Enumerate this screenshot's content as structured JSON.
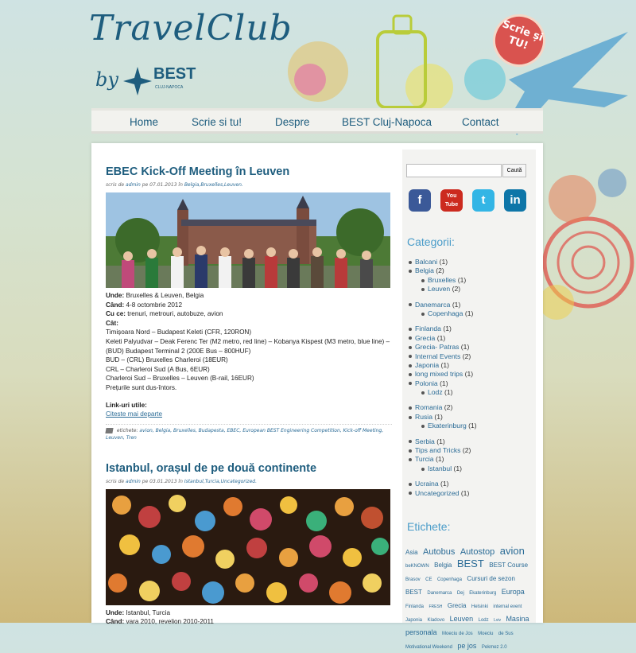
{
  "site": {
    "logo_text": "TravelClub",
    "logo_by": "by",
    "best_logo_text": "BEST",
    "best_logo_sub": "CLUJ-NAPOCA",
    "scrie_tag": "Scrie și TU!"
  },
  "nav": {
    "items": [
      {
        "label": "Home"
      },
      {
        "label": "Scrie si tu!"
      },
      {
        "label": "Despre"
      },
      {
        "label": "BEST Cluj-Napoca"
      },
      {
        "label": "Contact"
      }
    ]
  },
  "posts": [
    {
      "title": "EBEC Kick-Off Meeting în Leuven",
      "meta_prefix": "scris de",
      "meta_author": "admin",
      "meta_on": "pe 07.01.2013 în",
      "meta_cats": "Belgia,Bruxelles,Leuven.",
      "unde_label": "Unde:",
      "unde_value": " Bruxelles & Leuven, Belgia",
      "cand_label": "Când:",
      "cand_value": " 4-8 octombrie 2012",
      "cu_ce_label": "Cu ce:",
      "cu_ce_value": " trenuri, metrouri, autobuze, avion",
      "cat_label": "Cât:",
      "cat_lines": [
        "Timișoara Nord – Budapest Keleti (CFR, 120RON)",
        "Keleti Palyudvar – Deak Ferenc Ter (M2 metro, red line) – Kobanya Kispest (M3 metro, blue line) – (BUD) Budapest Terminal 2 (200E Bus – 800HUF)",
        "BUD – (CRL) Bruxelles Charleroi (18EUR)",
        "CRL – Charleroi Sud (A Bus, 6EUR)",
        "Charleroi Sud – Bruxelles – Leuven (B-rail, 16EUR)",
        "Prețurile sunt dus-întors."
      ],
      "links_label": "Link-uri utile:",
      "link_text": "Citeste mai departe",
      "tags_prefix": "etichete:",
      "tags": "avion, Belgia, Bruxelles, Budapesta, EBEC, European BEST Engineering Competition, Kick-off Meeting, Leuven, Tren"
    },
    {
      "title": "Istanbul, orașul de pe două continente",
      "meta_prefix": "scris de",
      "meta_author": "admin",
      "meta_on": "pe 03.01.2013 în",
      "meta_cats": "Istanbul,Turcia,Uncategorized.",
      "unde_label": "Unde:",
      "unde_value": " Istanbul, Turcia",
      "cand_label": "Când:",
      "cand_value": " vara 2010, revelion 2010-2011"
    }
  ],
  "sidebar": {
    "search_placeholder": "",
    "search_button": "Caută",
    "social": [
      {
        "label": "f",
        "color": "#3b5998"
      },
      {
        "label": "You Tube",
        "color": "#cc2a1f"
      },
      {
        "label": "t",
        "color": "#33b5e5"
      },
      {
        "label": "in",
        "color": "#0e76a8"
      }
    ],
    "categories_title": "Categorii:",
    "categories": [
      {
        "name": "Balcani",
        "count": "(1)",
        "level": 0
      },
      {
        "name": "Belgia",
        "count": "(2)",
        "level": 0
      },
      {
        "name": "Bruxelles",
        "count": "(1)",
        "level": 1
      },
      {
        "name": "Leuven",
        "count": "(2)",
        "level": 1
      },
      {
        "gap": true
      },
      {
        "name": "Danemarca",
        "count": "(1)",
        "level": 0
      },
      {
        "name": "Copenhaga",
        "count": "(1)",
        "level": 1
      },
      {
        "gap": true
      },
      {
        "name": "Finlanda",
        "count": "(1)",
        "level": 0
      },
      {
        "name": "Grecia",
        "count": "(1)",
        "level": 0
      },
      {
        "name": "Grecia- Patras",
        "count": "(1)",
        "level": 0
      },
      {
        "name": "Internal Events",
        "count": "(2)",
        "level": 0
      },
      {
        "name": "Japonia",
        "count": "(1)",
        "level": 0
      },
      {
        "name": "long mixed trips",
        "count": "(1)",
        "level": 0
      },
      {
        "name": "Polonia",
        "count": "(1)",
        "level": 0
      },
      {
        "name": "Lodz",
        "count": "(1)",
        "level": 1
      },
      {
        "gap": true
      },
      {
        "name": "Romania",
        "count": "(2)",
        "level": 0
      },
      {
        "name": "Rusia",
        "count": "(1)",
        "level": 0
      },
      {
        "name": "Ekaterinburg",
        "count": "(1)",
        "level": 1
      },
      {
        "gap": true
      },
      {
        "name": "Serbia",
        "count": "(1)",
        "level": 0
      },
      {
        "name": "Tips and Tricks",
        "count": "(2)",
        "level": 0
      },
      {
        "name": "Turcia",
        "count": "(1)",
        "level": 0
      },
      {
        "name": "Istanbul",
        "count": "(1)",
        "level": 1
      },
      {
        "gap": true
      },
      {
        "name": "Ucraina",
        "count": "(1)",
        "level": 0
      },
      {
        "name": "Uncategorized",
        "count": "(1)",
        "level": 0
      }
    ],
    "tags_title": "Etichete:",
    "tag_cloud": [
      {
        "t": "Asia",
        "s": 8
      },
      {
        "t": "Autobus",
        "s": 11
      },
      {
        "t": "Autostop",
        "s": 11
      },
      {
        "t": "avion",
        "s": 13
      },
      {
        "t": "beKNOWN",
        "s": 6
      },
      {
        "t": "Belgia",
        "s": 8
      },
      {
        "t": "BEST",
        "s": 13
      },
      {
        "t": "BEST Course",
        "s": 8
      },
      {
        "t": "Brasov",
        "s": 6
      },
      {
        "t": "CE",
        "s": 6
      },
      {
        "t": "Copenhaga",
        "s": 6
      },
      {
        "t": "Cursuri de sezon",
        "s": 8
      },
      {
        "t": "BEST",
        "s": 8
      },
      {
        "t": "Danemarca",
        "s": 6
      },
      {
        "t": "Dej",
        "s": 6
      },
      {
        "t": "Ekaterinburg",
        "s": 6
      },
      {
        "t": "Europa",
        "s": 9
      },
      {
        "t": "Finlanda",
        "s": 6
      },
      {
        "t": "FRESH",
        "s": 5
      },
      {
        "t": "Grecia",
        "s": 8
      },
      {
        "t": "Helsinki",
        "s": 6
      },
      {
        "t": "internal event",
        "s": 6
      },
      {
        "t": "Japonia",
        "s": 6
      },
      {
        "t": "Kladovo",
        "s": 6
      },
      {
        "t": "Leuven",
        "s": 9
      },
      {
        "t": "Lodz",
        "s": 6
      },
      {
        "t": "Lviv",
        "s": 5
      },
      {
        "t": "Masina personala",
        "s": 9
      },
      {
        "t": "Moeciu de Jos",
        "s": 6
      },
      {
        "t": "Moeciu",
        "s": 6
      },
      {
        "t": "de Sus",
        "s": 6
      },
      {
        "t": "Motivational Weekend",
        "s": 6
      },
      {
        "t": "pe jos",
        "s": 9
      },
      {
        "t": "Pekmez 2.0",
        "s": 6
      }
    ]
  }
}
